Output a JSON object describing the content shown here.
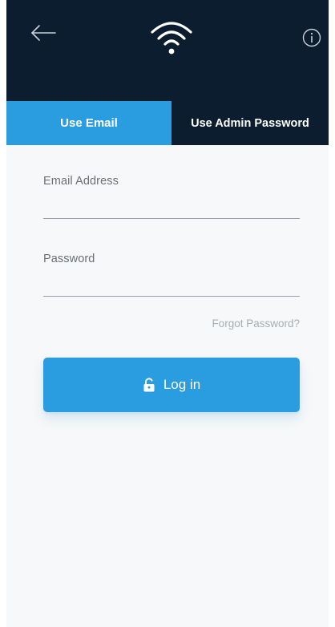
{
  "tabs": {
    "email_label": "Use Email",
    "admin_label": "Use Admin Password"
  },
  "form": {
    "email_label": "Email Address",
    "email_value": "",
    "password_label": "Password",
    "password_value": "",
    "forgot_label": "Forgot Password?",
    "login_label": "Log in"
  },
  "icons": {
    "back": "arrow-left-icon",
    "wifi": "wifi-icon",
    "info": "info-icon",
    "lock": "unlock-icon"
  },
  "colors": {
    "header_bg": "#0b1d2f",
    "accent": "#2a9de0",
    "page_bg": "#f7f8f9"
  }
}
